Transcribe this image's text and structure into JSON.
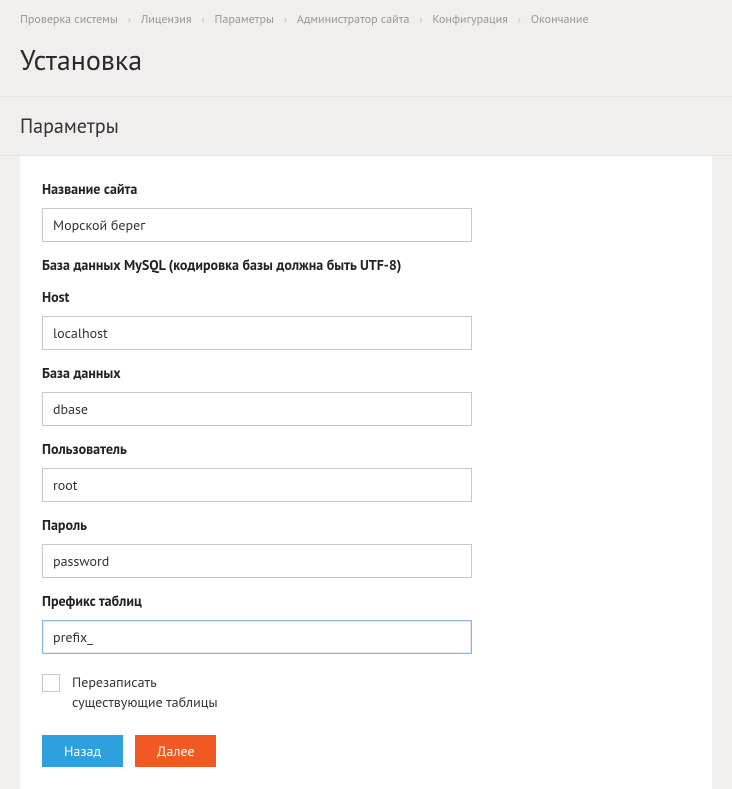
{
  "breadcrumb": {
    "items": [
      "Проверка системы",
      "Лицензия",
      "Параметры",
      "Администратор сайта",
      "Конфигурация",
      "Окончание"
    ]
  },
  "page": {
    "title": "Установка",
    "section": "Параметры"
  },
  "form": {
    "site_name": {
      "label": "Название сайта",
      "value": "Морской берег"
    },
    "db_section": "База данных MySQL (кодировка базы должна быть UTF-8)",
    "host": {
      "label": "Host",
      "value": "localhost"
    },
    "database": {
      "label": "База данных",
      "value": "dbase"
    },
    "user": {
      "label": "Пользователь",
      "value": "root"
    },
    "password": {
      "label": "Пароль",
      "value": "password"
    },
    "prefix": {
      "label": "Префикс таблиц",
      "value": "prefix_"
    },
    "overwrite": {
      "line1": "Перезаписать",
      "line2": "существующие таблицы"
    }
  },
  "buttons": {
    "back": "Назад",
    "next": "Далее"
  }
}
